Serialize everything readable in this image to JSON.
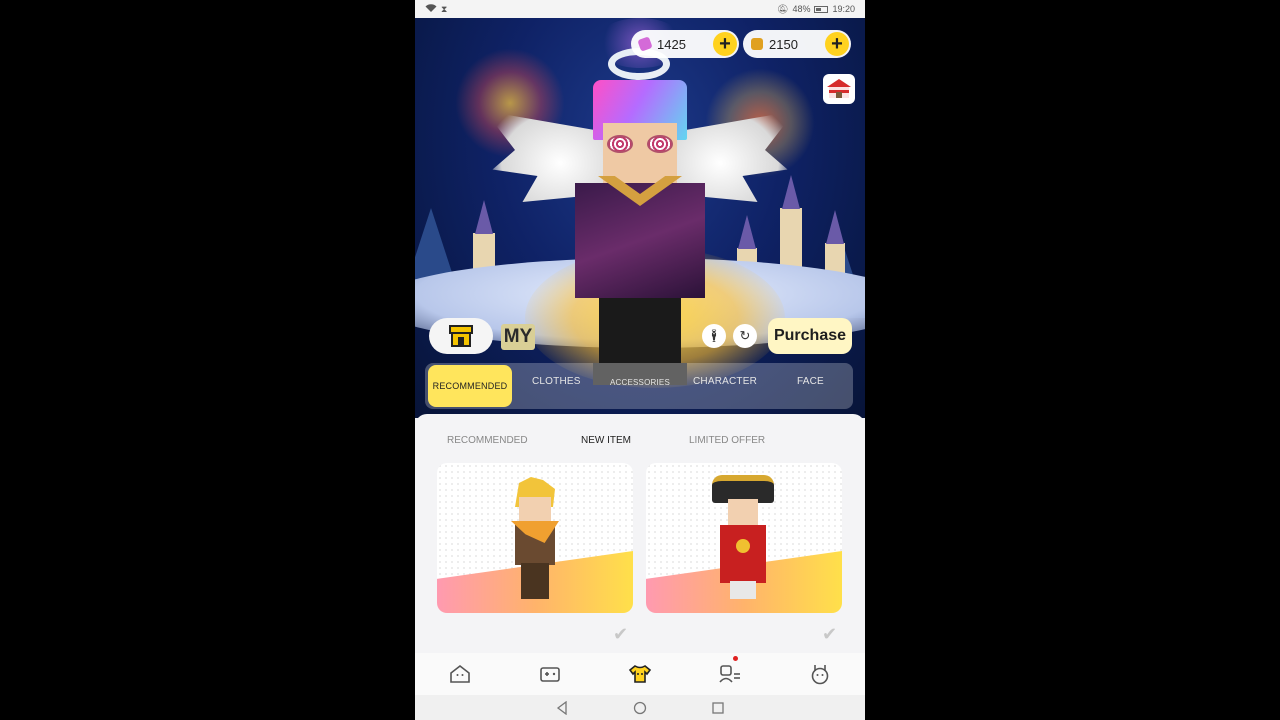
{
  "status_bar": {
    "battery": "48%",
    "time": "19:20"
  },
  "currency": [
    {
      "name": "gems",
      "amount": "1425",
      "icon": "ticket-icon",
      "color": "#d46ad8"
    },
    {
      "name": "cubes",
      "amount": "2150",
      "icon": "cube-icon",
      "color": "#e0a020"
    }
  ],
  "controls": {
    "shop_icon": "shop-icon",
    "my_label": "MY",
    "purchase_label": "Purchase"
  },
  "categories": [
    {
      "label": "RECOMMENDED",
      "active": true
    },
    {
      "label": "CLOTHES",
      "active": false
    },
    {
      "label": "ACCESSORIES",
      "active": false
    },
    {
      "label": "CHARACTER",
      "active": false
    },
    {
      "label": "FACE",
      "active": false
    }
  ],
  "subtabs": [
    {
      "label": "RECOMMENDED",
      "active": false
    },
    {
      "label": "NEW ITEM",
      "active": true
    },
    {
      "label": "LIMITED OFFER",
      "active": false
    }
  ],
  "items": [
    {
      "name": "blonde-adventurer-outfit",
      "owned": true
    },
    {
      "name": "red-emperor-outfit",
      "owned": true
    }
  ],
  "bottom_nav": [
    {
      "icon": "home-icon",
      "active": false
    },
    {
      "icon": "gamepad-icon",
      "active": false
    },
    {
      "icon": "tshirt-icon",
      "active": true
    },
    {
      "icon": "friends-icon",
      "active": false,
      "badge": true
    },
    {
      "icon": "profile-icon",
      "active": false
    }
  ],
  "colors": {
    "accent": "#ffd21f",
    "tab_active": "#ffe55c"
  }
}
